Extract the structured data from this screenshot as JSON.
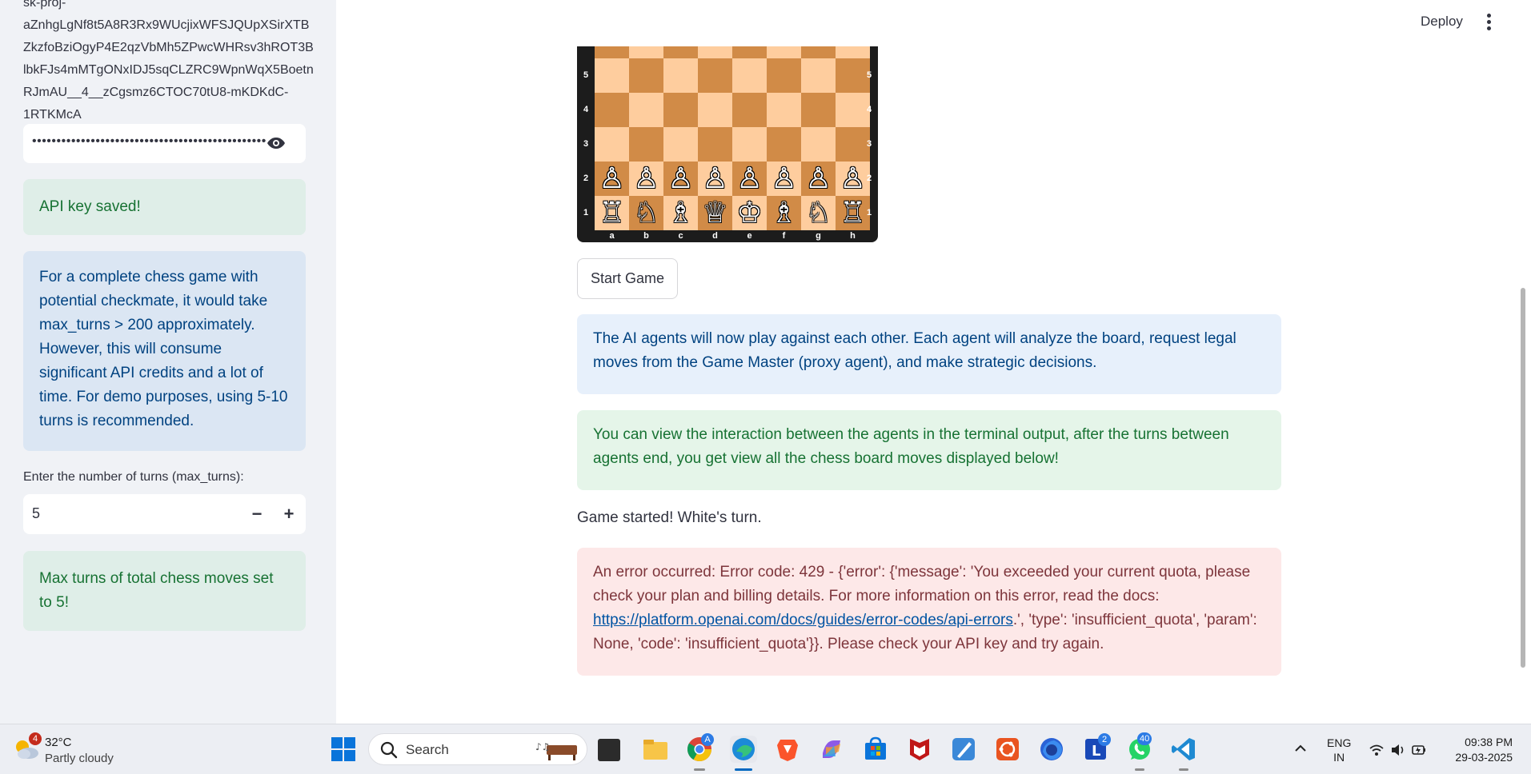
{
  "sidebar": {
    "token_lines": [
      "sk-proj-",
      "aZnhgLgNf8t5A8R3Rx9WUcjixWFSJQUpXSirXTB",
      "ZkzfoBziOgyP4E2qzVbMh5ZPwcWHRsv3hROT3B",
      "lbkFJs4mMTgONxIDJ5sqCLZRC9WpnWqX5Boetn",
      "RJmAU__4__zCgsmz6CTOC70tU8-mKDKdC-",
      "1RTKMcA"
    ],
    "api_key_masked": "••••••••••••••••••••••••••••••••••••••••••••••••",
    "api_saved_msg": "API key saved!",
    "info_msg": "For a complete chess game with potential checkmate, it would take max_turns > 200 approximately. However, this will consume significant API credits and a lot of time. For demo purposes, using 5-10 turns is recommended.",
    "turns_label": "Enter the number of turns (max_turns):",
    "turns_value": "5",
    "minus_label": "−",
    "plus_label": "+",
    "max_turns_msg": "Max turns of total chess moves set to 5!"
  },
  "header": {
    "deploy_label": "Deploy"
  },
  "board": {
    "ranks": [
      "5",
      "4",
      "3",
      "2",
      "1"
    ],
    "files": [
      "a",
      "b",
      "c",
      "d",
      "e",
      "f",
      "g",
      "h"
    ],
    "pawn_row": [
      "♙",
      "♙",
      "♙",
      "♙",
      "♙",
      "♙",
      "♙",
      "♙"
    ],
    "back_row": [
      "♖",
      "♘",
      "♗",
      "♕",
      "♔",
      "♗",
      "♘",
      "♖"
    ]
  },
  "main": {
    "start_button": "Start Game",
    "info_msg": "The AI agents will now play against each other. Each agent will analyze the board, request legal moves from the Game Master (proxy agent), and make strategic decisions.",
    "success_msg": "You can view the interaction between the agents in the terminal output, after the turns between agents end, you get view all the chess board moves displayed below!",
    "game_started": "Game started! White's turn.",
    "error_prefix": "An error occurred: Error code: 429 - {'error': {'message': 'You exceeded your current quota, please check your plan and billing details. For more information on this error, read the docs: ",
    "error_link": "https://platform.openai.com/docs/guides/error-codes/api-errors",
    "error_suffix": ".', 'type': 'insufficient_quota', 'param': None, 'code': 'insufficient_quota'}}. Please check your API key and try again."
  },
  "taskbar": {
    "weather_badge": "4",
    "weather_temp": "32°C",
    "weather_desc": "Partly cloudy",
    "search_placeholder": "Search",
    "chrome_badge": "A",
    "l_badge": "2",
    "whatsapp_badge": "40",
    "lang_line1": "ENG",
    "lang_line2": "IN",
    "time": "09:38 PM",
    "date": "29-03-2025"
  }
}
